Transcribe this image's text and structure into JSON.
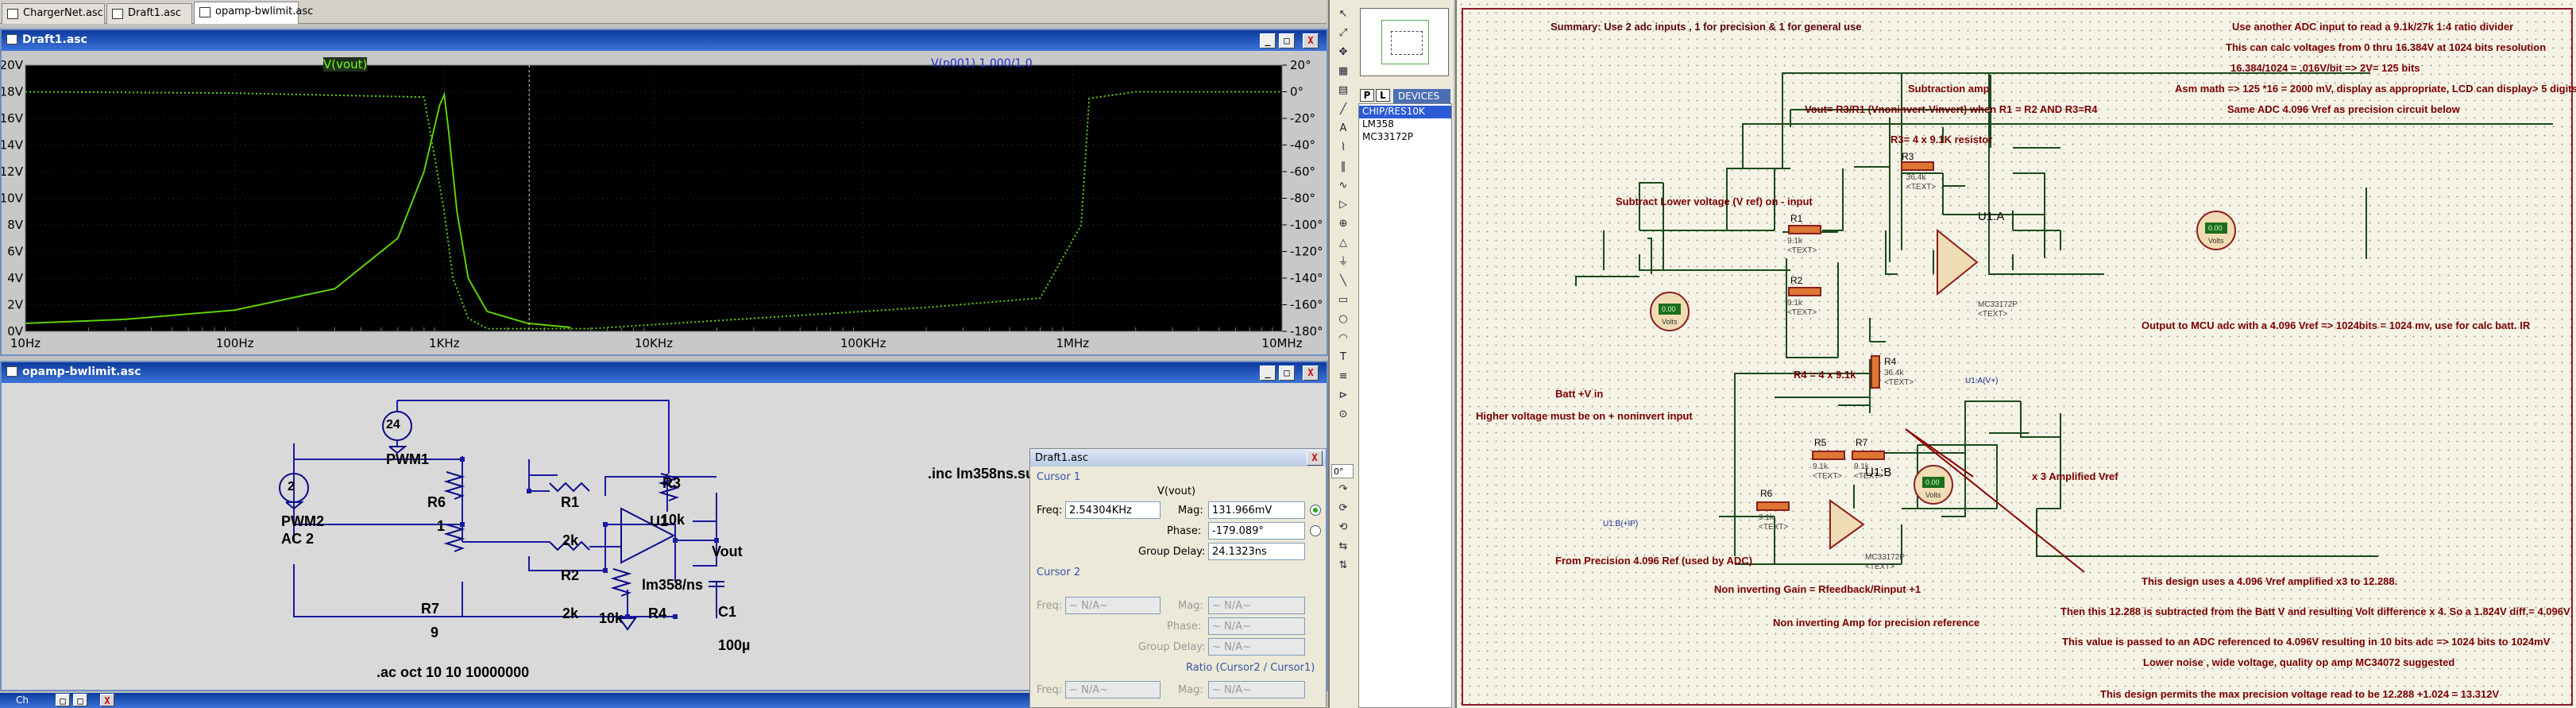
{
  "tabs": [
    {
      "label": "ChargerNet.asc",
      "active": false
    },
    {
      "label": "Draft1.asc",
      "active": false
    },
    {
      "label": "opamp-bwlimit.asc",
      "active": true
    }
  ],
  "plot_window": {
    "title": "Draft1.asc",
    "trace_label": "V(vout)",
    "cursor_overlay": "V(n001) 1.000/1.0"
  },
  "chart_data": {
    "type": "line",
    "title": "",
    "xscale": "log",
    "x_ticks": [
      "10Hz",
      "100Hz",
      "1KHz",
      "10KHz",
      "100KHz",
      "1MHz",
      "10MHz"
    ],
    "y_left_ticks": [
      "20V",
      "18V",
      "16V",
      "14V",
      "12V",
      "10V",
      "8V",
      "6V",
      "4V",
      "2V",
      "0V"
    ],
    "y_right_ticks": [
      "20°",
      "0°",
      "-20°",
      "-40°",
      "-60°",
      "-80°",
      "-100°",
      "-120°",
      "-140°",
      "-160°",
      "-180°"
    ],
    "ylim_left": [
      0,
      20
    ],
    "ylim_right": [
      -180,
      20
    ],
    "series": [
      {
        "name": "V(vout)",
        "axis": "left",
        "style": "solid",
        "x": [
          10,
          30,
          100,
          300,
          600,
          800,
          950,
          1000,
          1050,
          1150,
          1300,
          1600,
          2500,
          4000
        ],
        "values": [
          0.6,
          0.9,
          1.6,
          3.2,
          7,
          12,
          17,
          17.8,
          15,
          9,
          4,
          1.5,
          0.6,
          0.3
        ]
      },
      {
        "name": "V(vout)",
        "axis": "right",
        "style": "dotted",
        "x": [
          10,
          100,
          800,
          1000,
          1100,
          1300,
          1600,
          5000,
          50000,
          200000,
          700000,
          1100000,
          1200000,
          2000000,
          10000000
        ],
        "values": [
          0,
          -1,
          -4,
          -90,
          -140,
          -170,
          -178,
          -178,
          -168,
          -162,
          -155,
          -100,
          -5,
          0,
          0
        ]
      }
    ],
    "cursor_x": "2.54304KHz"
  },
  "schematic_window": {
    "title": "opamp-bwlimit.asc",
    "directive_inc": ".inc lm358ns.sub",
    "directive_ac": ".ac oct 10 10 10000000",
    "components": {
      "pwm1_value": "24",
      "pwm1_name": "PWM1",
      "pwm2_value": "2",
      "pwm2_name": "PWM2",
      "pwm2_ac": "AC 2",
      "r6_name": "R6",
      "r6_value": "1",
      "r7_name": "R7",
      "r7_value": "9",
      "r1_name": "R1",
      "r1_value": "2k",
      "r2_name": "R2",
      "r2_value": "2k",
      "r3_name": "R3",
      "r3_value": "10k",
      "r4_name": "R4",
      "r4_value": "10k",
      "u1_name": "U1",
      "u1_model": "lm358/ns",
      "c1_name": "C1",
      "c1_value": "100µ",
      "vout_label": "Vout"
    }
  },
  "cursor_dialog": {
    "title": "Draft1.asc",
    "cursor1_label": "Cursor 1",
    "column_header": "V(vout)",
    "freq_label": "Freq:",
    "freq_value": "2.54304KHz",
    "mag_label": "Mag:",
    "mag_value": "131.966mV",
    "phase_label": "Phase:",
    "phase_value": "-179.089°",
    "group_delay_label": "Group Delay:",
    "group_delay_value": "24.1323ns",
    "cursor2_label": "Cursor 2",
    "na_value": "~ N/A~",
    "ratio_label": "Ratio (Cursor2 / Cursor1)"
  },
  "bottom_bar": {
    "label": "Ch"
  },
  "component_panel": {
    "tabs": [
      "P",
      "L"
    ],
    "devices_label": "DEVICES",
    "items": [
      "CHIP/RES10K",
      "LM358",
      "MC33172P"
    ]
  },
  "sidebar_tools": [
    "arrow",
    "zoom-fit",
    "pan",
    "hand",
    "grid",
    "wire",
    "label",
    "resistor",
    "capacitor",
    "inductor",
    "diode",
    "source",
    "opamp",
    "ground",
    "line",
    "rect",
    "circle",
    "arc",
    "text",
    "bus",
    "terminal",
    "probe",
    "undo",
    "redo",
    "rotate-cw",
    "rotate-ccw",
    "mirror",
    "flip"
  ],
  "sidebar_zoom": "0°",
  "proteus": {
    "summary": "Summary: Use 2 adc inputs , 1 for precision  & 1 for general use",
    "right_notes": [
      "Use another ADC input to read a 9.1k/27k 1:4 ratio divider",
      "This can calc voltages from 0 thru 16.384V at 1024 bits resolution",
      "16.384/1024 = .016V/bit => 2V= 125 bits",
      "Asm math => 125 *16 = 2000 mV, display as appropriate, LCD can display> 5 digits",
      "Same ADC 4.096 Vref  as  precision circuit below"
    ],
    "subtraction_title": "Subtraction amp",
    "subtraction_eq": "Vout= R3/R1 (Vnoninvert-Vinvert)  when R1 = R2 AND R3=R4",
    "r3_note": "R3= 4 x 9.1K resistor",
    "subtract_note": "Subtract Lower voltage (V ref) on - input",
    "r4_note": "R4 = 4 x 9.1k",
    "batt_label": "Batt +V in",
    "higher_note": "Higher voltage must be on + noninvert input",
    "output_note": "Output to MCU adc with a 4.096 Vref => 1024bits = 1024 mv, use for calc batt. IR",
    "amplified_note": "x 3 Amplified Vref",
    "precision_ref": "From Precision 4.096 Ref (used by ADC)",
    "gain_note": "Non inverting Gain = Rfeedback/Rinput +1",
    "noninv_amp": "Non inverting Amp for  precision reference",
    "design_notes": [
      "This design  uses a 4.096 Vref amplified x3 to 12.288.",
      "Then this 12.288 is subtracted from the Batt V and resulting Volt difference x 4. So a 1.824V diff.= 4.096V",
      "This  value is  passed to an ADC referenced to 4.096V resulting in 10 bits adc => 1024 bits to 1024mV",
      "Lower noise ,  wide voltage, quality op amp MC34072 suggested",
      "This design permits the max precision voltage read to be 12.288 +1.024 = 13.312V"
    ],
    "parts": {
      "r1": "R1",
      "r2": "R2",
      "r3": "R3",
      "r4": "R4",
      "r5": "R5",
      "r6": "R6",
      "r7": "R7",
      "r1v": "9.1k",
      "r2v": "9.1k",
      "r3v": "36.4k",
      "r4v": "36.4k",
      "r5v": "9.1k",
      "r6v": "9.1k",
      "r7v": "9.1k",
      "text": "<TEXT>",
      "u1a": "U1:A",
      "u1b": "U1:B",
      "model": "MC33172P",
      "volts": "Volts",
      "meter_val": "0.00",
      "u1a_probe": "U1:A(V+)",
      "u1b_probe": "U1:B(+IP)"
    }
  }
}
